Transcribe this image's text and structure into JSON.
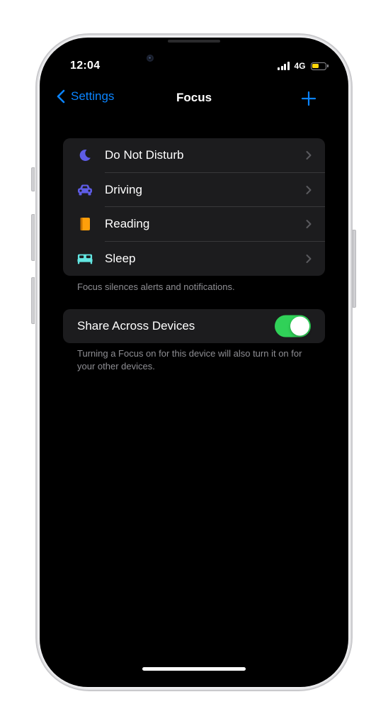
{
  "status_bar": {
    "time": "12:04",
    "network": "4G",
    "battery_color": "#ffd60a",
    "battery_level_fraction": 0.55
  },
  "nav": {
    "back_label": "Settings",
    "title": "Focus",
    "add_icon": "plus-icon",
    "accent_color": "#0a84ff"
  },
  "focus_modes": [
    {
      "label": "Do Not Disturb",
      "icon": "moon-icon",
      "color": "#5e5ce6"
    },
    {
      "label": "Driving",
      "icon": "car-icon",
      "color": "#5e5ce6"
    },
    {
      "label": "Reading",
      "icon": "book-icon",
      "color": "#ff9f0a"
    },
    {
      "label": "Sleep",
      "icon": "bed-icon",
      "color": "#63e6e2"
    }
  ],
  "focus_footer": "Focus silences alerts and notifications.",
  "share": {
    "label": "Share Across Devices",
    "enabled": true,
    "toggle_color": "#30d158",
    "footer": "Turning a Focus on for this device will also turn it on for your other devices."
  }
}
